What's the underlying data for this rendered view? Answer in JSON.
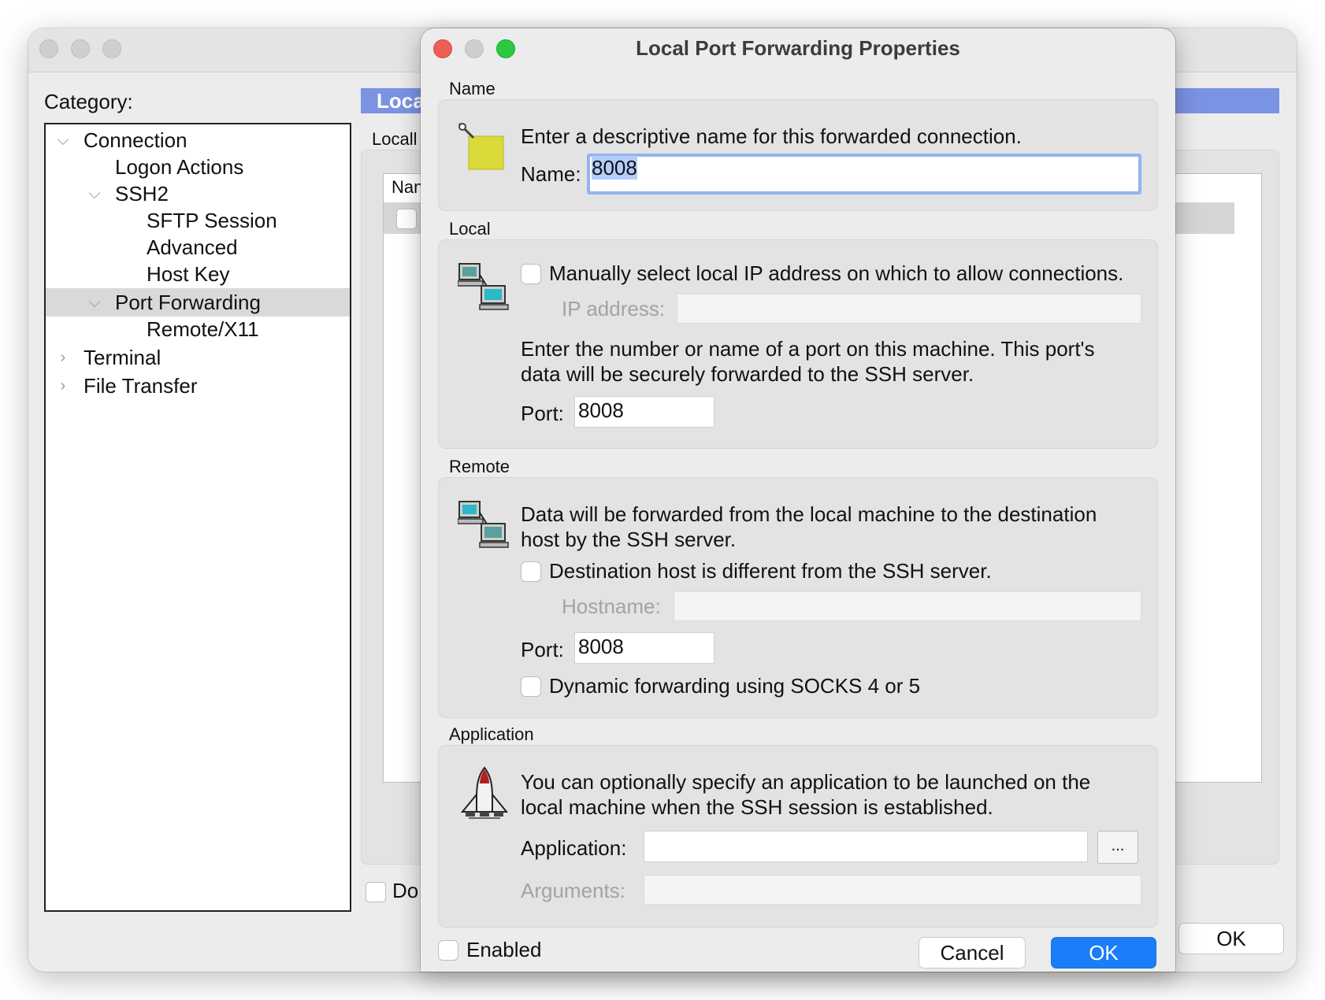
{
  "background_window": {
    "category_label": "Category:",
    "tree": [
      {
        "label": "Connection",
        "expanded": true
      },
      {
        "label": "Logon Actions"
      },
      {
        "label": "SSH2",
        "expanded": true
      },
      {
        "label": "SFTP Session"
      },
      {
        "label": "Advanced"
      },
      {
        "label": "Host Key"
      },
      {
        "label": "Port Forwarding",
        "expanded": true,
        "selected": true
      },
      {
        "label": "Remote/X11"
      },
      {
        "label": "Terminal",
        "expanded": false
      },
      {
        "label": "File Transfer",
        "expanded": false
      }
    ],
    "header_bar": "Loca",
    "sublabel": "Locall",
    "list_header": "Nan",
    "dont_label": "Do",
    "ok_label": "OK"
  },
  "dialog": {
    "title": "Local Port Forwarding Properties",
    "name_section": {
      "label": "Name",
      "description": "Enter a descriptive name for this forwarded connection.",
      "field_label": "Name:",
      "value": "8008"
    },
    "local_section": {
      "label": "Local",
      "manual_ip_checkbox": "Manually select local IP address on which to allow connections.",
      "ip_label": "IP address:",
      "ip_value": "",
      "description_line1": "Enter the number or name of a port on this machine.  This port's",
      "description_line2": "data will be securely forwarded to the SSH server.",
      "port_label": "Port:",
      "port_value": "8008"
    },
    "remote_section": {
      "label": "Remote",
      "description_line1": "Data will be forwarded from the local machine to the destination",
      "description_line2": "host by the SSH server.",
      "dest_checkbox": "Destination host is different from the SSH server.",
      "hostname_label": "Hostname:",
      "hostname_value": "",
      "port_label": "Port:",
      "port_value": "8008",
      "socks_checkbox": "Dynamic forwarding using SOCKS 4 or 5"
    },
    "application_section": {
      "label": "Application",
      "description_line1": "You can optionally specify an application to be launched on the",
      "description_line2": "local machine when the SSH session is established.",
      "app_label": "Application:",
      "app_value": "",
      "browse_label": "...",
      "args_label": "Arguments:",
      "args_value": ""
    },
    "enabled_checkbox": "Enabled",
    "cancel_label": "Cancel",
    "ok_label": "OK"
  },
  "colors": {
    "accent_blue": "#1c7df8",
    "header_bar": "#7b93e3",
    "close_red": "#ed5e56",
    "zoom_green": "#2bc840",
    "focus_ring": "#93b4ee"
  }
}
